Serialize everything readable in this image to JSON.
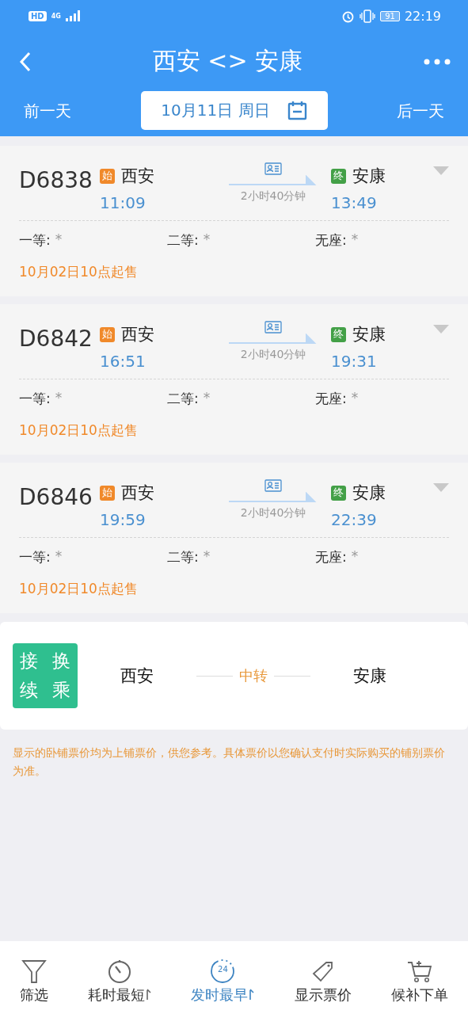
{
  "status_bar": {
    "hd": "HD",
    "network": "4G",
    "battery": "91",
    "time": "22:19"
  },
  "header": {
    "title": "西安 <> 安康",
    "prev_day": "前一天",
    "date": "10月11日 周日",
    "next_day": "后一天"
  },
  "trains": [
    {
      "train_no": "D6838",
      "from": {
        "badge": "始",
        "color": "#f0892a",
        "station": "西安",
        "time": "11:09"
      },
      "duration": "2小时40分钟",
      "to": {
        "badge": "终",
        "color": "#43a047",
        "station": "安康",
        "time": "13:49"
      },
      "seats": [
        {
          "label": "一等:",
          "value": "*"
        },
        {
          "label": "二等:",
          "value": "*"
        },
        {
          "label": "无座:",
          "value": "*"
        }
      ],
      "presale": "10月02日10点起售"
    },
    {
      "train_no": "D6842",
      "from": {
        "badge": "始",
        "color": "#f0892a",
        "station": "西安",
        "time": "16:51"
      },
      "duration": "2小时40分钟",
      "to": {
        "badge": "终",
        "color": "#43a047",
        "station": "安康",
        "time": "19:31"
      },
      "seats": [
        {
          "label": "一等:",
          "value": "*"
        },
        {
          "label": "二等:",
          "value": "*"
        },
        {
          "label": "无座:",
          "value": "*"
        }
      ],
      "presale": "10月02日10点起售"
    },
    {
      "train_no": "D6846",
      "from": {
        "badge": "始",
        "color": "#f0892a",
        "station": "西安",
        "time": "19:59"
      },
      "duration": "2小时40分钟",
      "to": {
        "badge": "终",
        "color": "#43a047",
        "station": "安康",
        "time": "22:39"
      },
      "seats": [
        {
          "label": "一等:",
          "value": "*"
        },
        {
          "label": "二等:",
          "value": "*"
        },
        {
          "label": "无座:",
          "value": "*"
        }
      ],
      "presale": "10月02日10点起售"
    }
  ],
  "transfer": {
    "badge": [
      "接",
      "换",
      "续",
      "乘"
    ],
    "from": "西安",
    "via": "中转",
    "to": "安康"
  },
  "notice": "显示的卧铺票价均为上铺票价，供您参考。具体票价以您确认支付时实际购买的铺别票价为准。",
  "bottom_bar": [
    {
      "kind": "filter",
      "label": "筛选",
      "selected": false,
      "sort_indicator": false
    },
    {
      "kind": "stopwatch",
      "label": "耗时最短",
      "selected": false,
      "sort_indicator": true
    },
    {
      "kind": "clock24",
      "icon_text": "24",
      "label": "发时最早",
      "selected": true,
      "sort_indicator": true
    },
    {
      "kind": "tag",
      "label": "显示票价",
      "selected": false,
      "sort_indicator": false
    },
    {
      "kind": "cart",
      "label": "候补下单",
      "selected": false,
      "sort_indicator": false
    }
  ]
}
